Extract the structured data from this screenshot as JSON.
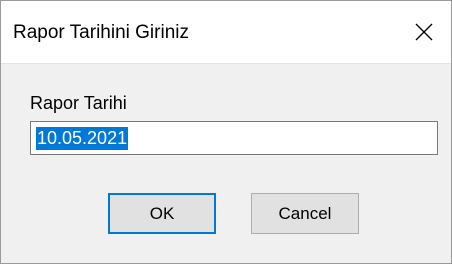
{
  "dialog": {
    "title": "Rapor Tarihini Giriniz",
    "close_icon": "close-icon"
  },
  "form": {
    "label": "Rapor Tarihi",
    "date_value": "10.05.2021",
    "value_selected": true
  },
  "buttons": {
    "ok_label": "OK",
    "cancel_label": "Cancel"
  },
  "colors": {
    "selection": "#0078d7",
    "titlebar": "#ffffff",
    "background": "#f0f0f0"
  }
}
